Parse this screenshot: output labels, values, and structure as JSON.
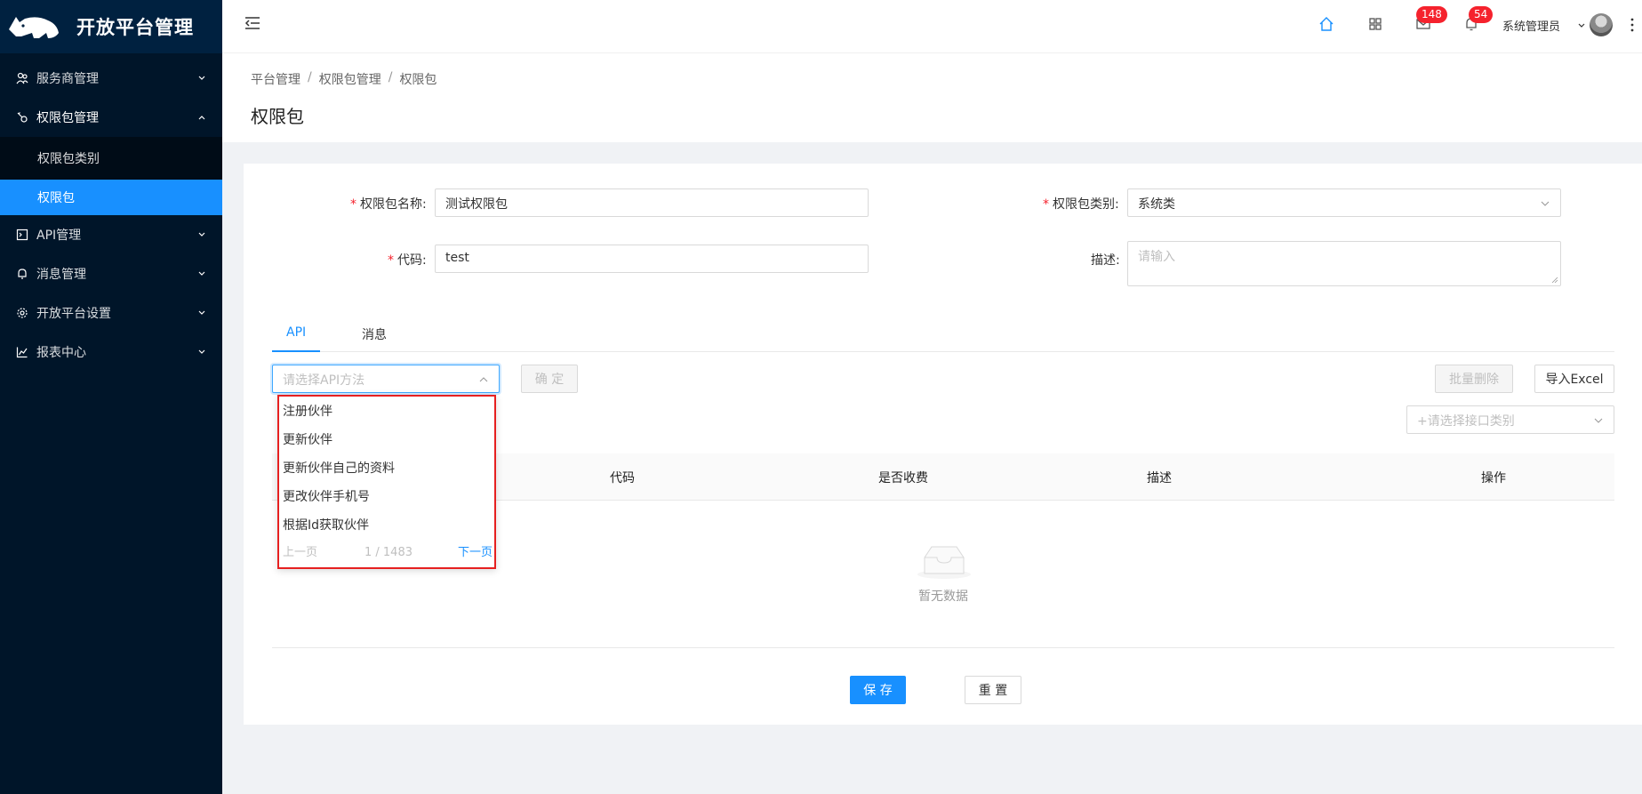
{
  "app": {
    "title": "开放平台管理"
  },
  "sidebar": {
    "items": [
      {
        "label": "服务商管理",
        "icon": "team-icon"
      },
      {
        "label": "权限包管理",
        "icon": "key-icon"
      },
      {
        "label": "API管理",
        "icon": "api-icon"
      },
      {
        "label": "消息管理",
        "icon": "bell-icon"
      },
      {
        "label": "开放平台设置",
        "icon": "gear-icon"
      },
      {
        "label": "报表中心",
        "icon": "chart-icon"
      }
    ],
    "sub_items": [
      {
        "label": "权限包类别"
      },
      {
        "label": "权限包"
      }
    ]
  },
  "header": {
    "mail_count": "148",
    "bell_count": "54",
    "username": "系统管理员"
  },
  "breadcrumb": [
    "平台管理",
    "权限包管理",
    "权限包"
  ],
  "breadcrumb_sep": "/",
  "page": {
    "title": "权限包"
  },
  "form": {
    "name_label": "权限包名称:",
    "name_value": "测试权限包",
    "category_label": "权限包类别:",
    "category_value": "系统类",
    "code_label": "代码:",
    "code_value": "test",
    "desc_label": "描述:",
    "desc_placeholder": "请输入",
    "required_mark": "*"
  },
  "tabs": [
    {
      "label": "API"
    },
    {
      "label": "消息"
    }
  ],
  "toolbar": {
    "api_placeholder": "请选择API方法",
    "confirm": "确 定",
    "batch_delete": "批量删除",
    "import_excel": "导入Excel",
    "iface_placeholder": "+请选择接口类别"
  },
  "table": {
    "columns": [
      "代码",
      "是否收费",
      "描述",
      "操作"
    ],
    "empty_text": "暂无数据"
  },
  "dropdown": {
    "options": [
      "注册伙伴",
      "更新伙伴",
      "更新伙伴自己的资料",
      "更改伙伴手机号",
      "根据Id获取伙伴"
    ],
    "prev": "上一页",
    "page_info": "1 / 1483",
    "next": "下一页"
  },
  "actions": {
    "save": "保 存",
    "reset": "重 置"
  },
  "colors": {
    "primary": "#1890ff",
    "sidebar": "#001529",
    "highlight_border": "#e62020"
  }
}
